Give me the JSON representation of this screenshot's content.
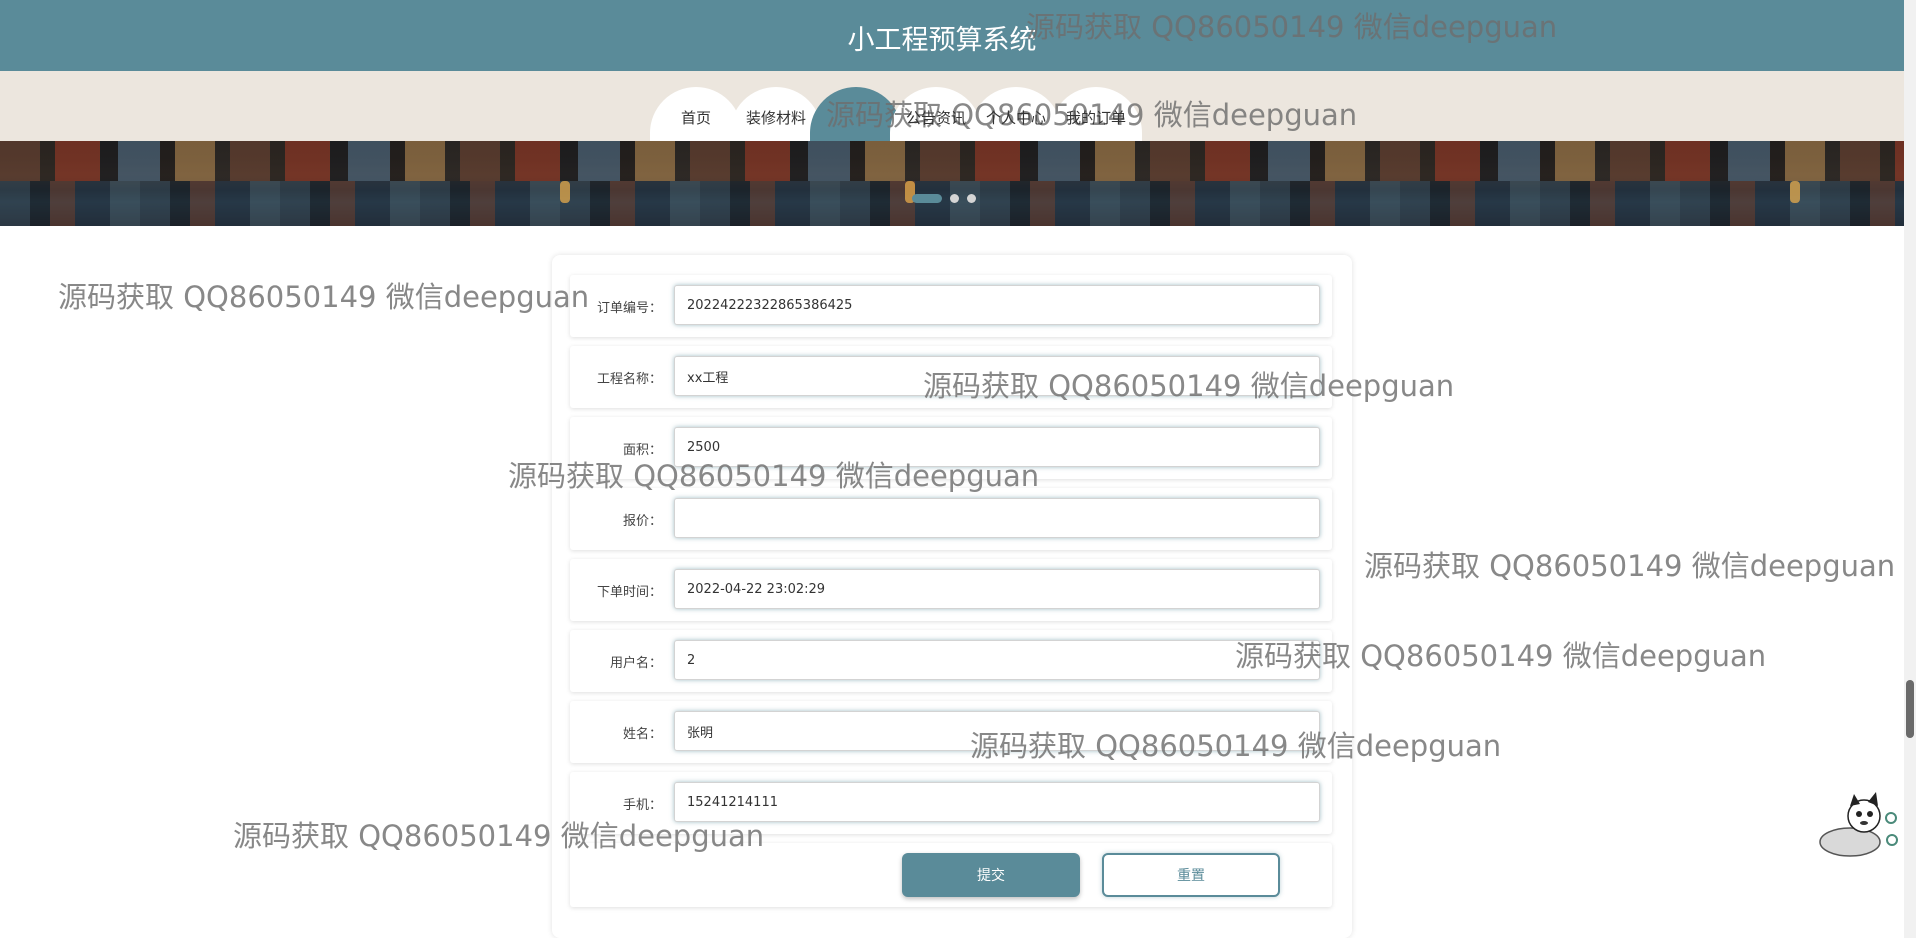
{
  "header": {
    "title": "小工程预算系统"
  },
  "nav": {
    "items": [
      {
        "label": "首页"
      },
      {
        "label": "装修材料"
      },
      {
        "label": ""
      },
      {
        "label": "公告资讯"
      },
      {
        "label": "个人中心"
      },
      {
        "label": "我的订单"
      }
    ],
    "active_index": 2
  },
  "carousel": {
    "slides": 3,
    "active": 0
  },
  "form": {
    "order_no": {
      "label": "订单编号：",
      "value": "20224222322865386425"
    },
    "project_name": {
      "label": "工程名称：",
      "value": "xx工程"
    },
    "area": {
      "label": "面积：",
      "value": "2500"
    },
    "price": {
      "label": "报价：",
      "value": ""
    },
    "order_time": {
      "label": "下单时间：",
      "value": "2022-04-22 23:02:29"
    },
    "username": {
      "label": "用户名：",
      "value": "2"
    },
    "name": {
      "label": "姓名：",
      "value": "张明"
    },
    "phone": {
      "label": "手机：",
      "value": "15241214111"
    },
    "submit_label": "提交",
    "reset_label": "重置"
  },
  "watermark": {
    "text": "源码获取 QQ86050149 微信deepguan"
  },
  "colors": {
    "primary": "#5a8b99",
    "nav_bg": "#ece6de"
  }
}
